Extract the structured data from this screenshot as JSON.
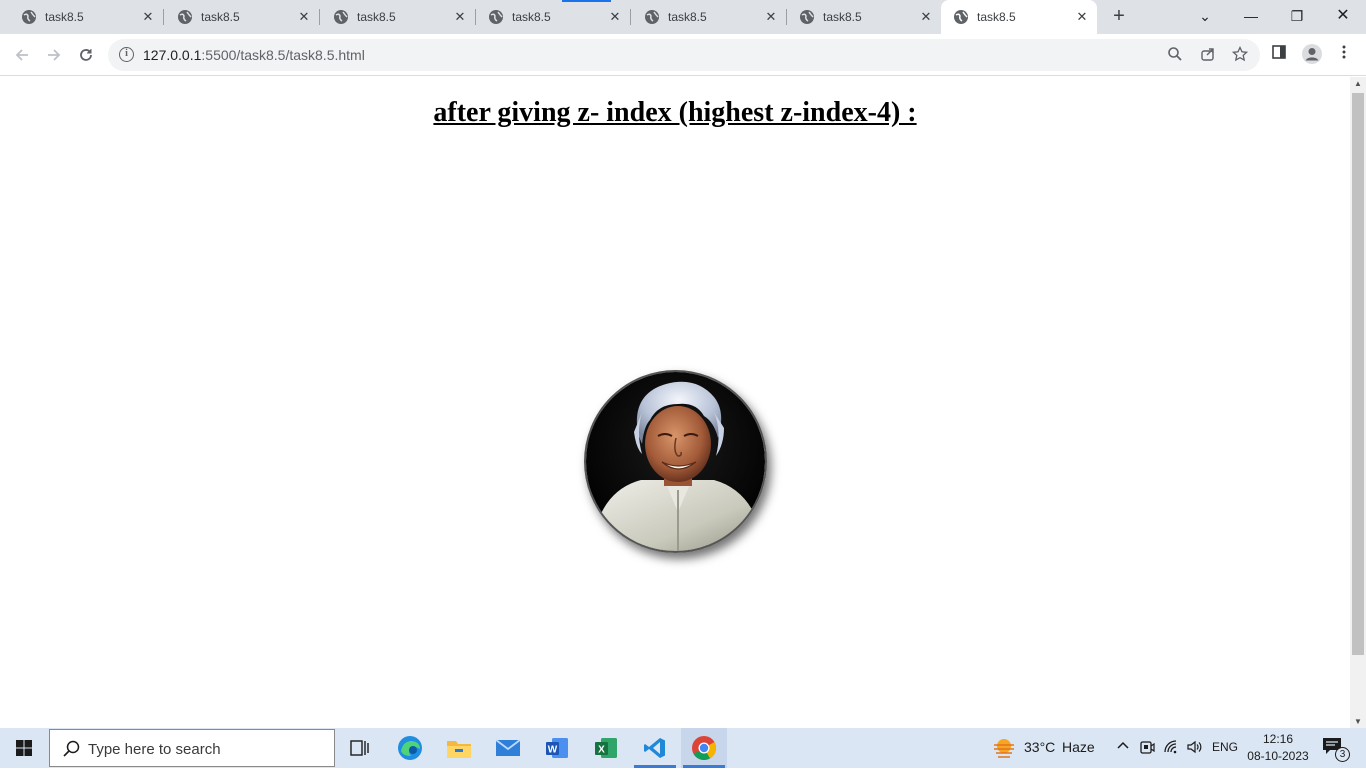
{
  "browser": {
    "tabs": [
      {
        "title": "task8.5",
        "active": false
      },
      {
        "title": "task8.5",
        "active": false
      },
      {
        "title": "task8.5",
        "active": false
      },
      {
        "title": "task8.5",
        "active": false
      },
      {
        "title": "task8.5",
        "active": false
      },
      {
        "title": "task8.5",
        "active": false
      },
      {
        "title": "task8.5",
        "active": true
      }
    ],
    "tab_close_glyph": "✕",
    "new_tab_glyph": "+",
    "window_controls": {
      "tab_search": "⌄",
      "minimize": "—",
      "restore": "❐",
      "close": "✕"
    },
    "address": {
      "host": "127.0.0.1",
      "path": ":5500/task8.5/task8.5.html"
    },
    "accent_color": "#1a73e8"
  },
  "page": {
    "heading": "after giving z- index (highest z-index-4) :"
  },
  "taskbar": {
    "search_placeholder": "Type here to search",
    "apps": [
      "task-view",
      "edge",
      "file-explorer",
      "mail",
      "word",
      "excel",
      "vscode",
      "chrome"
    ],
    "weather": {
      "temp": "33°C",
      "condition": "Haze"
    },
    "language": "ENG",
    "time": "12:16",
    "date": "08-10-2023",
    "notification_count": "3"
  }
}
